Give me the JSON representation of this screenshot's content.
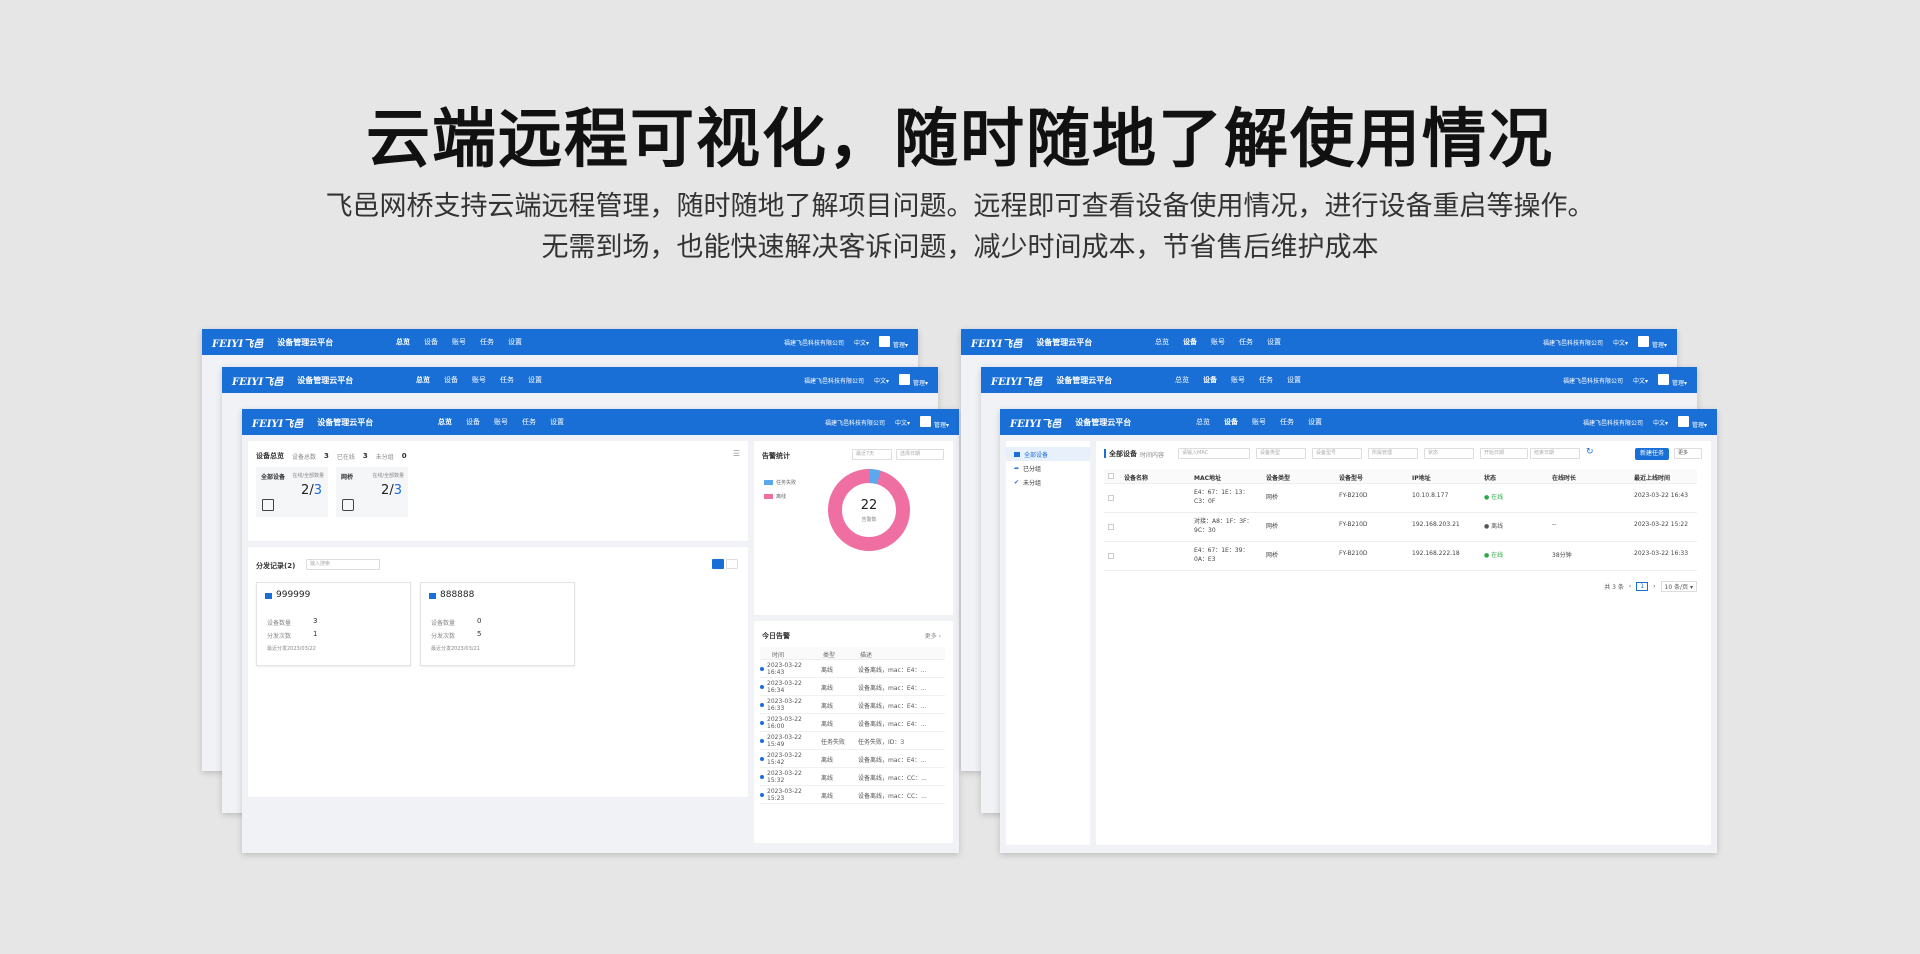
{
  "headline": "云端远程可视化，随时随地了解使用情况",
  "subline1": "飞邑网桥支持云端远程管理，随时随地了解项目问题。远程即可查看设备使用情况，进行设备重启等操作。",
  "subline2": "无需到场，也能快速解决客诉问题，减少时间成本，节省售后维护成本",
  "app": {
    "logo": "FEIYI飞邑",
    "platform": "设备管理云平台",
    "nav": [
      "总览",
      "设备",
      "账号",
      "任务",
      "设置"
    ],
    "company": "福建飞邑科技有限公司",
    "lang": "中文▾",
    "user": "管理▾"
  },
  "overview": {
    "title": "设备总览",
    "stats": [
      {
        "label": "设备总数",
        "value": "3"
      },
      {
        "label": "已在线",
        "value": "3"
      },
      {
        "label": "未分组",
        "value": "0"
      }
    ],
    "cards": [
      {
        "name": "全部设备",
        "hint": "在线/全部数量",
        "online": "2",
        "total": "3"
      },
      {
        "name": "网桥",
        "hint": "在线/全部数量",
        "online": "2",
        "total": "3"
      }
    ],
    "alarm_title": "告警统计",
    "alarm_filter1": "最近7天",
    "alarm_filter2": "选择日期",
    "alarm_legend": [
      "任务失败",
      "离线"
    ],
    "alarm_total": "22",
    "alarm_total_label": "告警数",
    "groups_title": "分发记录(2)",
    "groups_search": "输入搜索",
    "groups": [
      {
        "name": "999999",
        "device_label": "设备数量",
        "device_count": "3",
        "dist_label": "分发次数",
        "dist_count": "1",
        "last": "最近分发2023/03/22"
      },
      {
        "name": "888888",
        "device_label": "设备数量",
        "device_count": "0",
        "dist_label": "分发次数",
        "dist_count": "5",
        "last": "最近分发2023/03/21"
      }
    ],
    "today_title": "今日告警",
    "today_more": "更多 ›",
    "today_headers": [
      "时间",
      "类型",
      "描述"
    ],
    "today_rows": [
      {
        "time": "2023-03-22 16:43",
        "type": "离线",
        "desc": "设备离线，mac：E4：..."
      },
      {
        "time": "2023-03-22 16:34",
        "type": "离线",
        "desc": "设备离线，mac：E4：..."
      },
      {
        "time": "2023-03-22 16:33",
        "type": "离线",
        "desc": "设备离线，mac：E4：..."
      },
      {
        "time": "2023-03-22 16:00",
        "type": "离线",
        "desc": "设备离线，mac：E4：..."
      },
      {
        "time": "2023-03-22 15:49",
        "type": "任务失败",
        "desc": "任务失败，ID：3"
      },
      {
        "time": "2023-03-22 15:42",
        "type": "离线",
        "desc": "设备离线，mac：E4：..."
      },
      {
        "time": "2023-03-22 15:32",
        "type": "离线",
        "desc": "设备离线，mac：CC：..."
      },
      {
        "time": "2023-03-22 15:23",
        "type": "离线",
        "desc": "设备离线，mac：CC：..."
      }
    ]
  },
  "devices": {
    "sidebar": [
      "全部设备",
      "已分组",
      "未分组"
    ],
    "tab": "全部设备",
    "filter_label": "时间内容",
    "filters": [
      "请输入MAC",
      "设备类型",
      "设备型号",
      "所属管理",
      "状态",
      "开始日期",
      "结束日期"
    ],
    "new_task": "新建任务",
    "more": "更多",
    "headers": [
      "设备名称",
      "MAC地址",
      "设备类型",
      "设备型号",
      "IP地址",
      "状态",
      "在线时长",
      "最近上线时间"
    ],
    "rows": [
      {
        "mac": "E4：67：1E：13：C3：0F",
        "type": "网桥",
        "model": "FY-B210D",
        "ip": "10.10.8.177",
        "status": "在线",
        "uptime": "",
        "last": "2023-03-22 16:43"
      },
      {
        "mac": "对接：A8：1F：3F：9C：30",
        "type": "网桥",
        "model": "FY-B210D",
        "ip": "192.168.203.21",
        "status": "离线",
        "uptime": "--",
        "last": "2023-03-22 15:22"
      },
      {
        "mac": "E4：67：1E：39：0A：E3",
        "type": "网桥",
        "model": "FY-B210D",
        "ip": "192.168.222.18",
        "status": "在线",
        "uptime": "38分钟",
        "last": "2023-03-22 16:33"
      }
    ],
    "pager_total": "共 3 条",
    "pager_page": "1",
    "pager_size": "10 条/页 ▾"
  },
  "colors": {
    "brand": "#1a6fd6",
    "online": "#2ba84a",
    "pink": "#f06fa3"
  }
}
